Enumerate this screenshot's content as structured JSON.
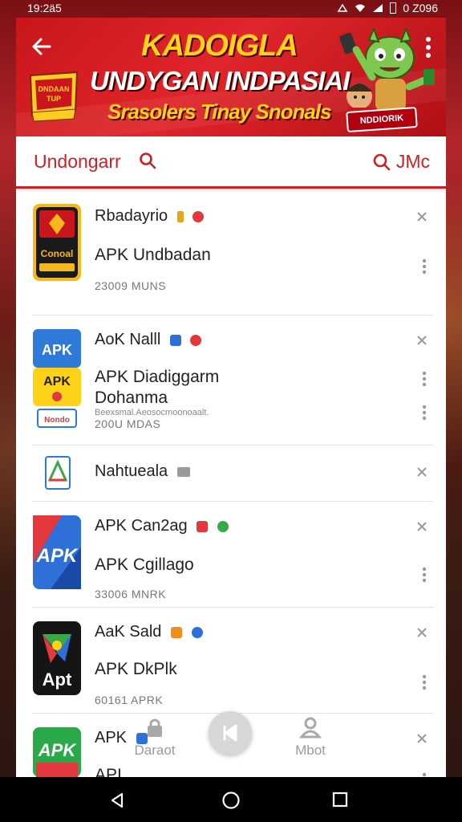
{
  "status_bar": {
    "time": "19:2ä5",
    "battery_text": "0 Z096"
  },
  "banner": {
    "title": "KADOIGLA",
    "subtitle": "UNDYGAN INDPASIAI",
    "tagline": "Srasolers Tinay Snonals",
    "ribbon": "NDDIORIK",
    "badge_lines": [
      "DNDAAN",
      "TUP"
    ]
  },
  "search_bar": {
    "label": "Undongarr",
    "right_label": "JMc"
  },
  "list": [
    {
      "title": "Rbadayrio",
      "subtitle": "APK Undbadan",
      "meta": "23009 MUNS",
      "fine": "",
      "extra": "",
      "badge_colors": [
        "#e8a21c",
        "#e2383e"
      ]
    },
    {
      "title": "AoK Nalll",
      "subtitle": "APK Diadiggarm",
      "extra": "Dohanma",
      "fine": "Beexsmal.Aeosocmoonoaalt.",
      "meta": "200U MDAS",
      "badge_colors": [
        "#2f6fd8",
        "#e2383e"
      ]
    },
    {
      "title": "Nahtueala",
      "subtitle": "",
      "extra": "",
      "fine": "",
      "meta": "",
      "badge_colors": [
        "#9a9a9a"
      ]
    },
    {
      "title": "APK Can2ag",
      "subtitle": "APK Cgillago",
      "meta": "33006 MNRK",
      "fine": "",
      "extra": "",
      "badge_colors": [
        "#e2383e",
        "#3aa84a"
      ]
    },
    {
      "title": "AaK Sald",
      "subtitle": "APK DkPlk",
      "meta": "60161 APRK",
      "fine": "",
      "extra": "",
      "badge_colors": [
        "#f28c1c",
        "#2f6fd8"
      ]
    },
    {
      "title": "APK",
      "subtitle": "API",
      "meta": "",
      "fine": "",
      "extra": "",
      "badge_colors": [
        "#2f6fd8"
      ]
    }
  ],
  "app_icon_labels": {
    "icon1_text": "Conoal",
    "icon2_top": "APK",
    "icon2_mid": "APK",
    "icon2_bot": "Nondo",
    "icon4_text": "APK",
    "icon5_text": "Apt",
    "icon6_text": "APK"
  },
  "bottom_nav": {
    "left_label": "Daraot",
    "right_label": "Mbot"
  },
  "colors": {
    "brand_red": "#d01e22",
    "banner_yellow": "#ffd21a"
  }
}
